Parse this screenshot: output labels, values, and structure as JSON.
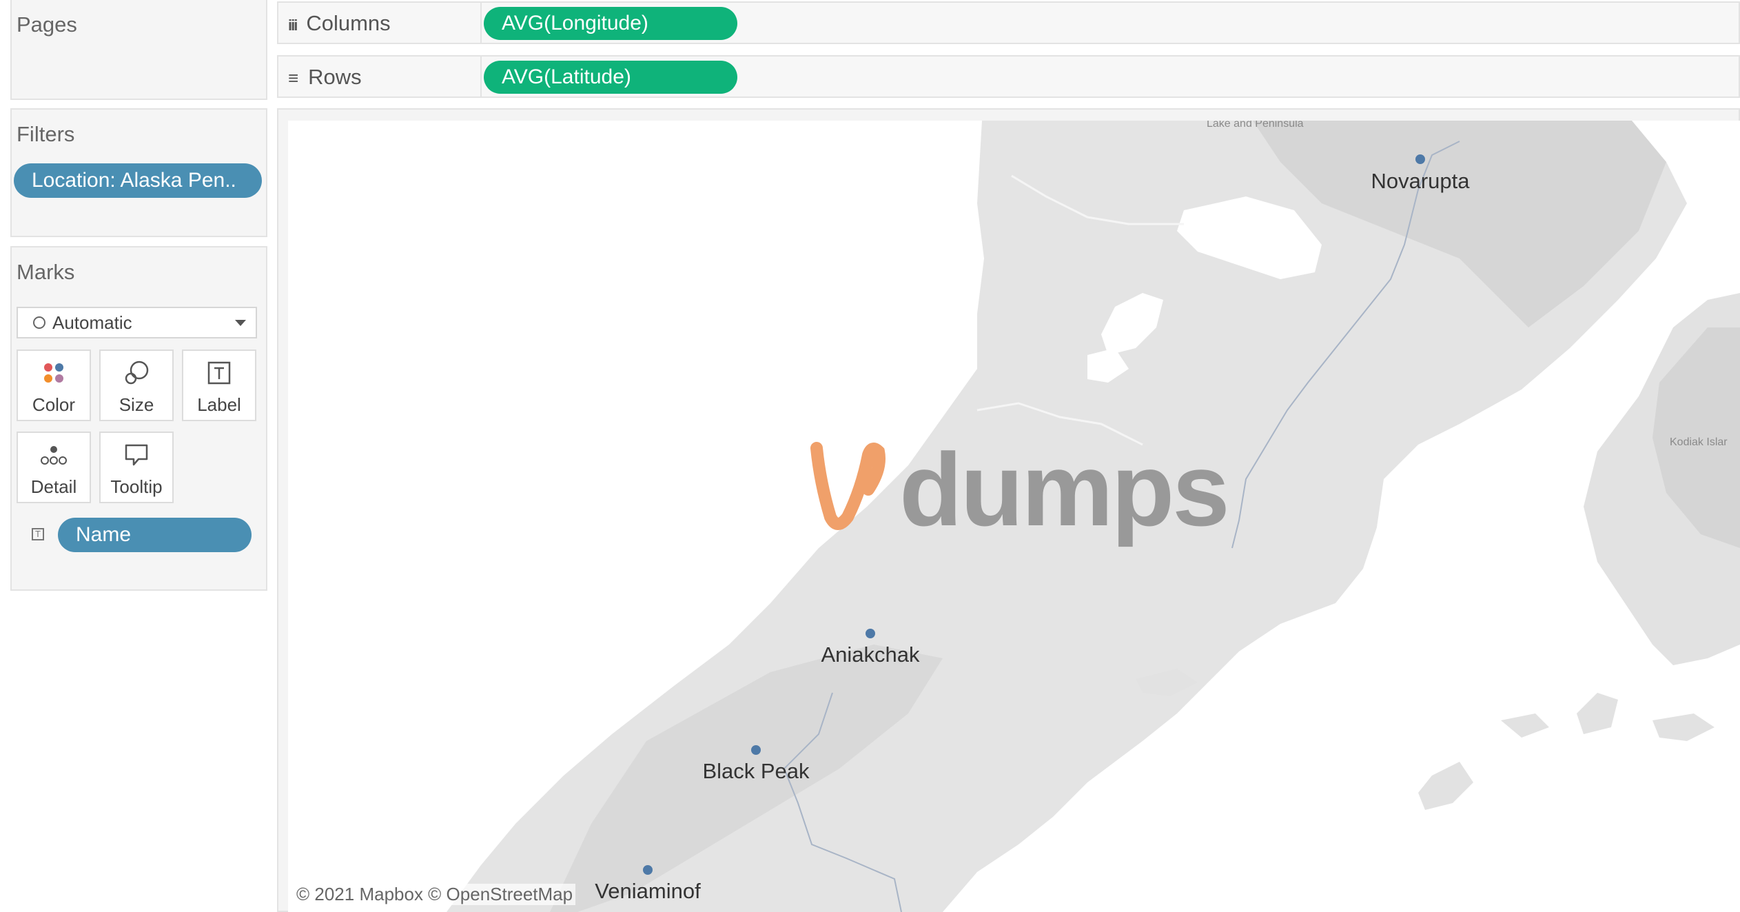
{
  "pages": {
    "title": "Pages"
  },
  "filters": {
    "title": "Filters",
    "pill": "Location: Alaska Pen.."
  },
  "marks": {
    "title": "Marks",
    "mark_type": "Automatic",
    "buttons": [
      {
        "label": "Color",
        "icon": "color-icon"
      },
      {
        "label": "Size",
        "icon": "size-icon"
      },
      {
        "label": "Label",
        "icon": "label-icon"
      },
      {
        "label": "Detail",
        "icon": "detail-icon"
      },
      {
        "label": "Tooltip",
        "icon": "tooltip-icon"
      }
    ],
    "field": "Name"
  },
  "shelves": {
    "columns": {
      "label": "Columns",
      "pill": "AVG(Longitude)"
    },
    "rows": {
      "label": "Rows",
      "pill": "AVG(Latitude)"
    }
  },
  "map": {
    "points": [
      {
        "name": "Novarupta"
      },
      {
        "name": "Aniakchak"
      },
      {
        "name": "Black Peak"
      },
      {
        "name": "Veniaminof"
      }
    ],
    "small_labels": [
      "Lake and Peninsula",
      "Kodiak Islar"
    ],
    "attribution": "© 2021 Mapbox © OpenStreetMap",
    "point_color": "#4e79a7"
  },
  "watermark": {
    "text": "dumps",
    "accent": "#f0a06a"
  },
  "colors": {
    "pill_green": "#0fb37a",
    "pill_blue": "#4a8fb3",
    "land": "#e6e6e6",
    "water": "#ffffff"
  }
}
